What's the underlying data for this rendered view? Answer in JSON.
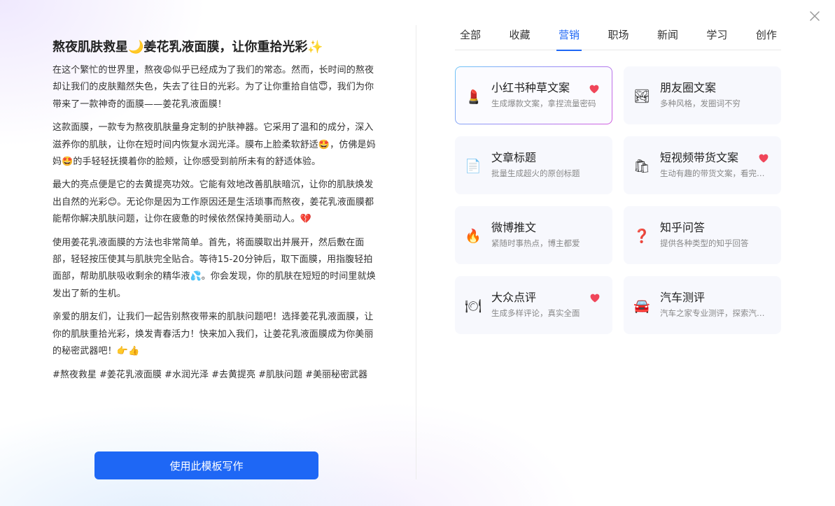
{
  "article": {
    "title": "熬夜肌肤救星🌙姜花乳液面膜，让你重拾光彩✨",
    "paragraphs": [
      "在这个繁忙的世界里，熬夜😩似乎已经成为了我们的常态。然而，长时间的熬夜却让我们的皮肤黯然失色，失去了往日的光彩。为了让你重拾自信😇，我们为你带来了一款神奇的面膜——姜花乳液面膜！",
      "这款面膜，一款专为熬夜肌肤量身定制的护肤神器。它采用了温和的成分，深入滋养你的肌肤，让你在短时间内恢复水润光泽。膜布上脸柔软舒适🤩，仿佛是妈妈🤩的手轻轻抚摸着你的脸颊，让你感受到前所未有的舒适体验。",
      "最大的亮点便是它的去黄提亮功效。它能有效地改善肌肤暗沉，让你的肌肤焕发出自然的光彩😊。无论你是因为工作原因还是生活琐事而熬夜，姜花乳液面膜都能帮你解决肌肤问题，让你在疲惫的时候依然保持美丽动人。💔",
      "使用姜花乳液面膜的方法也非常简单。首先，将面膜取出并展开，然后敷在面部，轻轻按压使其与肌肤完全贴合。等待15-20分钟后，取下面膜，用指腹轻拍面部，帮助肌肤吸收剩余的精华液💦。你会发现，你的肌肤在短短的时间里就焕发出了新的生机。",
      "亲爱的朋友们，让我们一起告别熬夜带来的肌肤问题吧！选择姜花乳液面膜，让你的肌肤重拾光彩，焕发青春活力！快来加入我们，让姜花乳液面膜成为你美丽的秘密武器吧！👉👍"
    ],
    "tags": "#熬夜救星 #姜花乳液面膜 #水润光泽 #去黄提亮 #肌肤问题 #美丽秘密武器"
  },
  "use_button_label": "使用此模板写作",
  "tabs": [
    {
      "label": "全部",
      "active": false
    },
    {
      "label": "收藏",
      "active": false
    },
    {
      "label": "营销",
      "active": true
    },
    {
      "label": "职场",
      "active": false
    },
    {
      "label": "新闻",
      "active": false
    },
    {
      "label": "学习",
      "active": false
    },
    {
      "label": "创作",
      "active": false
    }
  ],
  "templates": [
    {
      "title": "小红书种草文案",
      "desc": "生成爆款文案，拿捏流量密码",
      "icon": "lipstick-icon",
      "glyph": "💄",
      "favorite": true,
      "selected": true
    },
    {
      "title": "朋友圈文案",
      "desc": "多种风格，发圈词不穷",
      "icon": "landscape-picture-icon",
      "glyph": "🏞",
      "favorite": false,
      "selected": false
    },
    {
      "title": "文章标题",
      "desc": "批量生成超火的原创标题",
      "icon": "document-icon",
      "glyph": "📄",
      "favorite": false,
      "selected": false
    },
    {
      "title": "短视频带货文案",
      "desc": "生动有趣的带货文案，看完就想买",
      "icon": "shopping-bags-icon",
      "glyph": "🛍",
      "favorite": true,
      "selected": false
    },
    {
      "title": "微博推文",
      "desc": "紧随时事热点，博主都爱",
      "icon": "fire-icon",
      "glyph": "🔥",
      "favorite": false,
      "selected": false
    },
    {
      "title": "知乎问答",
      "desc": "提供各种类型的知乎回答",
      "icon": "question-mark-icon",
      "glyph": "❓",
      "favorite": false,
      "selected": false
    },
    {
      "title": "大众点评",
      "desc": "生成多样评论，真实全面",
      "icon": "plate-cutlery-icon",
      "glyph": "🍽",
      "favorite": true,
      "selected": false
    },
    {
      "title": "汽车测评",
      "desc": "汽车之家专业测评，探索汽车奥秘",
      "icon": "car-icon",
      "glyph": "🚘",
      "favorite": false,
      "selected": false
    }
  ],
  "colors": {
    "accent": "#1e67f5",
    "heart": "#f0465a",
    "card_bg": "#f7f8fd"
  }
}
